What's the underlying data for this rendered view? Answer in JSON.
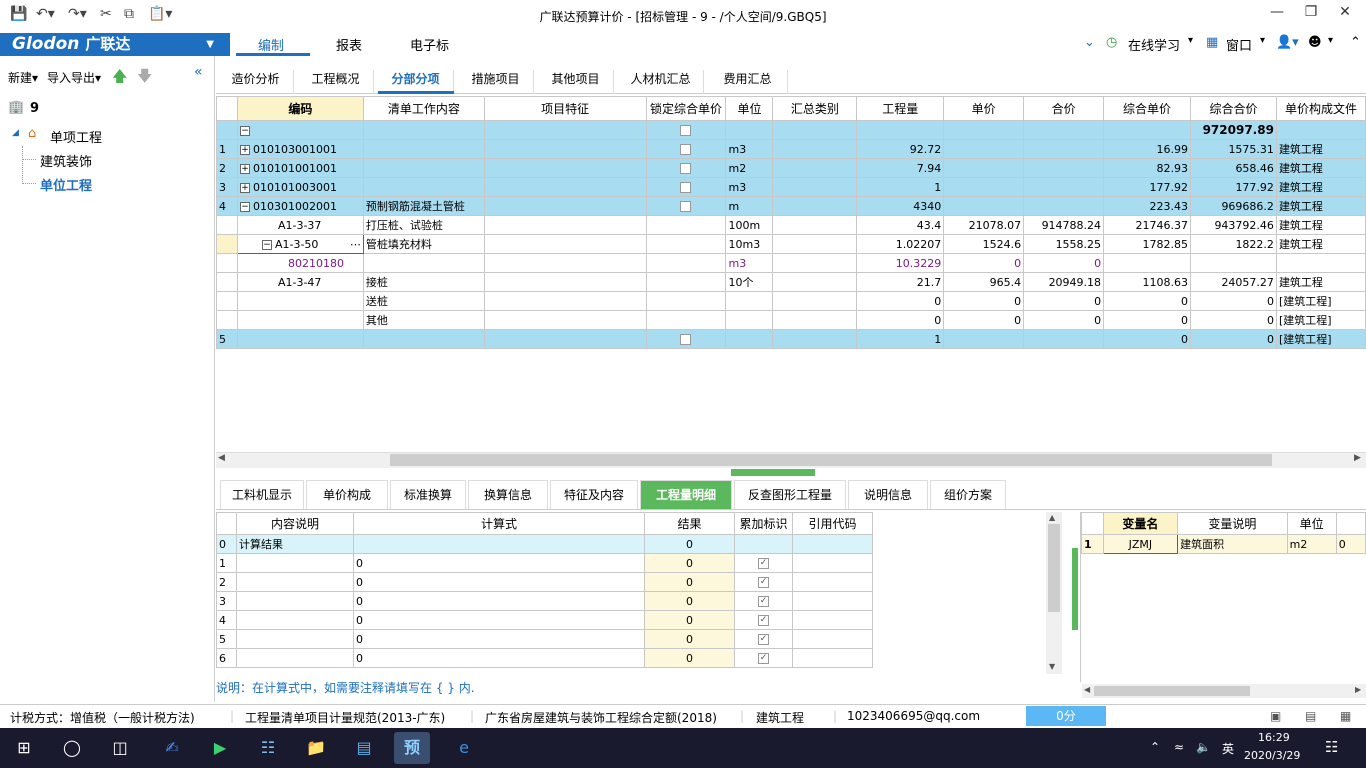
{
  "window": {
    "title": "广联达预算计价 - [招标管理 - 9 - /个人空间/9.GBQ5]"
  },
  "logo": {
    "brand": "Glodon",
    "cn": "广联达"
  },
  "menu": {
    "tabs": [
      "编制",
      "报表",
      "电子标"
    ],
    "online_learning": "在线学习",
    "window_label": "窗口"
  },
  "left": {
    "new_label": "新建",
    "import_export": "导入导出",
    "tree_root": "9",
    "tree_project": "单项工程",
    "tree_child1": "建筑装饰",
    "tree_child2": "单位工程"
  },
  "subtabs": [
    "造价分析",
    "工程概况",
    "分部分项",
    "措施项目",
    "其他项目",
    "人材机汇总",
    "费用汇总"
  ],
  "grid": {
    "headers": [
      "编码",
      "清单工作内容",
      "项目特征",
      "锁定综合单价",
      "单位",
      "汇总类别",
      "工程量",
      "单价",
      "合价",
      "综合单价",
      "综合合价",
      "单价构成文件"
    ],
    "total": "972097.89",
    "rows": [
      {
        "n": "1",
        "code": "010103001001",
        "unit": "m3",
        "qty": "92.72",
        "zhdj": "16.99",
        "zhhj": "1575.31",
        "file": "建筑工程"
      },
      {
        "n": "2",
        "code": "010101001001",
        "unit": "m2",
        "qty": "7.94",
        "zhdj": "82.93",
        "zhhj": "658.46",
        "file": "建筑工程"
      },
      {
        "n": "3",
        "code": "010101003001",
        "unit": "m3",
        "qty": "1",
        "zhdj": "177.92",
        "zhhj": "177.92",
        "file": "建筑工程"
      },
      {
        "n": "4",
        "code": "010301002001",
        "name": "预制钢筋混凝土管桩",
        "unit": "m",
        "qty": "4340",
        "zhdj": "223.43",
        "zhhj": "969686.2",
        "file": "建筑工程"
      }
    ],
    "sub": [
      {
        "code": "A1-3-37",
        "name": "打压桩、试验桩",
        "unit": "100m",
        "qty": "43.4",
        "dj": "21078.07",
        "hj": "914788.24",
        "zhdj": "21746.37",
        "zhhj": "943792.46",
        "file": "建筑工程"
      },
      {
        "code": "A1-3-50",
        "name": "管桩填充材料",
        "unit": "10m3",
        "qty": "1.02207",
        "dj": "1524.6",
        "hj": "1558.25",
        "zhdj": "1782.85",
        "zhhj": "1822.2",
        "file": "建筑工程"
      },
      {
        "code": "80210180",
        "unit": "m3",
        "qty": "10.3229",
        "dj": "0",
        "hj": "0"
      },
      {
        "code": "A1-3-47",
        "name": "接桩",
        "unit": "10个",
        "qty": "21.7",
        "dj": "965.4",
        "hj": "20949.18",
        "zhdj": "1108.63",
        "zhhj": "24057.27",
        "file": "建筑工程"
      },
      {
        "name": "送桩",
        "qty": "0",
        "dj": "0",
        "hj": "0",
        "zhdj": "0",
        "zhhj": "0",
        "file": "[建筑工程]"
      },
      {
        "name": "其他",
        "qty": "0",
        "dj": "0",
        "hj": "0",
        "zhdj": "0",
        "zhhj": "0",
        "file": "[建筑工程]"
      }
    ],
    "row5": {
      "n": "5",
      "qty": "1",
      "zhdj": "0",
      "zhhj": "0",
      "file": "[建筑工程]"
    }
  },
  "btabs": [
    "工料机显示",
    "单价构成",
    "标准换算",
    "换算信息",
    "特征及内容",
    "工程量明细",
    "反查图形工程量",
    "说明信息",
    "组价方案"
  ],
  "calc": {
    "headers": [
      "内容说明",
      "计算式",
      "结果",
      "累加标识",
      "引用代码"
    ],
    "first": {
      "n": "0",
      "desc": "计算结果",
      "result": "0"
    },
    "rows": [
      {
        "n": "1",
        "expr": "0",
        "result": "0"
      },
      {
        "n": "2",
        "expr": "0",
        "result": "0"
      },
      {
        "n": "3",
        "expr": "0",
        "result": "0"
      },
      {
        "n": "4",
        "expr": "0",
        "result": "0"
      },
      {
        "n": "5",
        "expr": "0",
        "result": "0"
      },
      {
        "n": "6",
        "expr": "0",
        "result": "0"
      }
    ]
  },
  "vars": {
    "headers": [
      "变量名",
      "变量说明",
      "单位"
    ],
    "row": {
      "n": "1",
      "name": "JZMJ",
      "desc": "建筑面积",
      "unit": "m2",
      "val": "0"
    }
  },
  "note": "说明：在计算式中，如需要注释请填写在 { } 内.",
  "status": {
    "tax": "计税方式：增值税（一般计税方法)",
    "spec": "工程量清单项目计量规范(2013-广东)",
    "quota": "广东省房屋建筑与装饰工程综合定额(2018)",
    "type": "建筑工程",
    "email": "1023406695@qq.com",
    "score": "0分"
  },
  "taskbar": {
    "ime": "英",
    "time": "16:29",
    "date": "2020/3/29"
  }
}
